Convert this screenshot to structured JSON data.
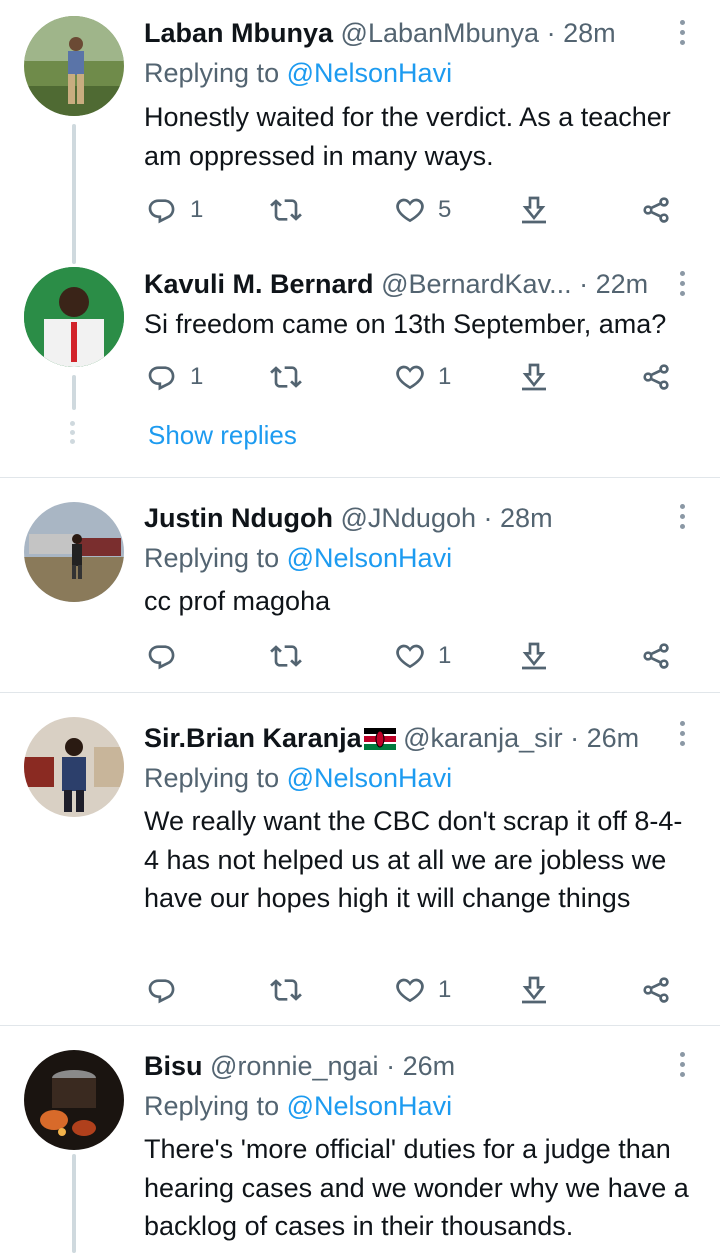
{
  "tweets": [
    {
      "name": "Laban Mbunya",
      "handle": "@LabanMbunya",
      "dot": "·",
      "time": "28m",
      "replying_prefix": "Replying to ",
      "replying_to": "@NelsonHavi",
      "text": "Honestly waited for the verdict. As a teacher am oppressed in many ways.",
      "replies": "1",
      "retweets": "",
      "likes": "5"
    },
    {
      "name": "Kavuli M. Bernard",
      "handle": "@BernardKav...",
      "dot": "·",
      "time": "22m",
      "text": "Si freedom came on 13th September, ama?",
      "replies": "1",
      "retweets": "",
      "likes": "1",
      "show_replies": "Show replies"
    },
    {
      "name": "Justin Ndugoh",
      "handle": "@JNdugoh",
      "dot": "·",
      "time": "28m",
      "replying_prefix": "Replying to ",
      "replying_to": "@NelsonHavi",
      "text": "cc prof magoha",
      "replies": "",
      "retweets": "",
      "likes": "1"
    },
    {
      "name": "Sir.Brian Karanja",
      "handle": "@karanja_sir",
      "dot": "·",
      "time": "26m",
      "replying_prefix": "Replying to ",
      "replying_to": "@NelsonHavi",
      "text": "We really want the CBC don't scrap it off 8-4-4 has not helped us at all we are jobless we have our hopes high it will change things",
      "replies": "",
      "retweets": "",
      "likes": "1"
    },
    {
      "name": "Bisu",
      "handle": "@ronnie_ngai",
      "dot": "·",
      "time": "26m",
      "replying_prefix": "Replying to ",
      "replying_to": "@NelsonHavi",
      "text": "There's 'more official' duties for a judge than hearing cases and we wonder why we have a backlog of cases in their thousands."
    }
  ],
  "icons": {
    "reply": "reply-icon",
    "retweet": "retweet-icon",
    "like": "heart-icon",
    "bookmark": "download-icon",
    "share": "share-icon",
    "more": "more-icon"
  },
  "colors": {
    "link": "#1d9bf0",
    "secondary": "#536471",
    "divider": "#e1e6ea"
  }
}
